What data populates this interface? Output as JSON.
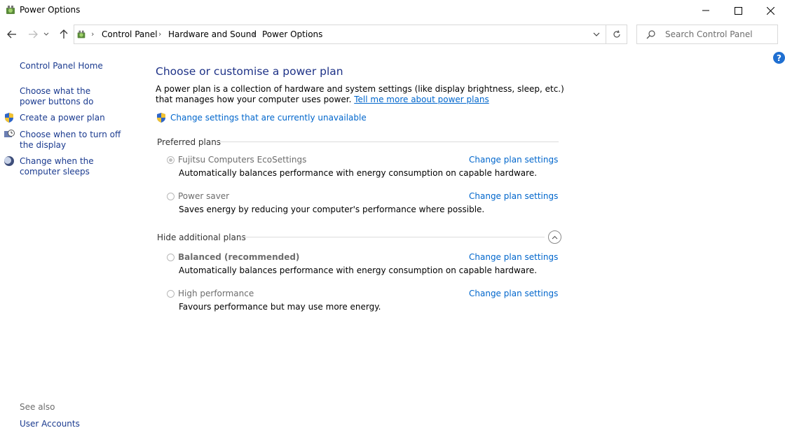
{
  "window": {
    "title": "Power Options",
    "minimize_glyph": "—",
    "maximize_glyph": "☐",
    "close_glyph": "✕"
  },
  "nav": {
    "breadcrumb": [
      "Control Panel",
      "Hardware and Sound",
      "Power Options"
    ],
    "search_placeholder": "Search Control Panel"
  },
  "sidebar": {
    "home": "Control Panel Home",
    "items": [
      {
        "label": "Choose what the power buttons do",
        "icon": null
      },
      {
        "label": "Create a power plan",
        "icon": "shield-icon"
      },
      {
        "label": "Choose when to turn off the display",
        "icon": "display-clock-icon"
      },
      {
        "label": "Change when the computer sleeps",
        "icon": "moon-icon"
      }
    ],
    "see_also_label": "See also",
    "see_also_links": [
      "User Accounts"
    ]
  },
  "main": {
    "heading": "Choose or customise a power plan",
    "description": "A power plan is a collection of hardware and system settings (like display brightness, sleep, etc.) that manages how your computer uses power.",
    "learn_more_link": "Tell me more about power plans",
    "admin_link": "Change settings that are currently unavailable",
    "preferred_label": "Preferred plans",
    "additional_label": "Hide additional plans",
    "change_link_label": "Change plan settings",
    "preferred_plans": [
      {
        "name": "Fujitsu Computers EcoSettings",
        "description": "Automatically balances performance with energy consumption on capable hardware.",
        "selected": true
      },
      {
        "name": "Power saver",
        "description": "Saves energy by reducing your computer's performance where possible.",
        "selected": false
      }
    ],
    "additional_plans": [
      {
        "name": "Balanced (recommended)",
        "description": "Automatically balances performance with energy consumption on capable hardware.",
        "selected": false
      },
      {
        "name": "High performance",
        "description": "Favours performance but may use more energy.",
        "selected": false
      }
    ]
  },
  "colors": {
    "link": "#0066cc",
    "heading": "#1e3287",
    "sidebar_link": "#1a3a8f"
  }
}
